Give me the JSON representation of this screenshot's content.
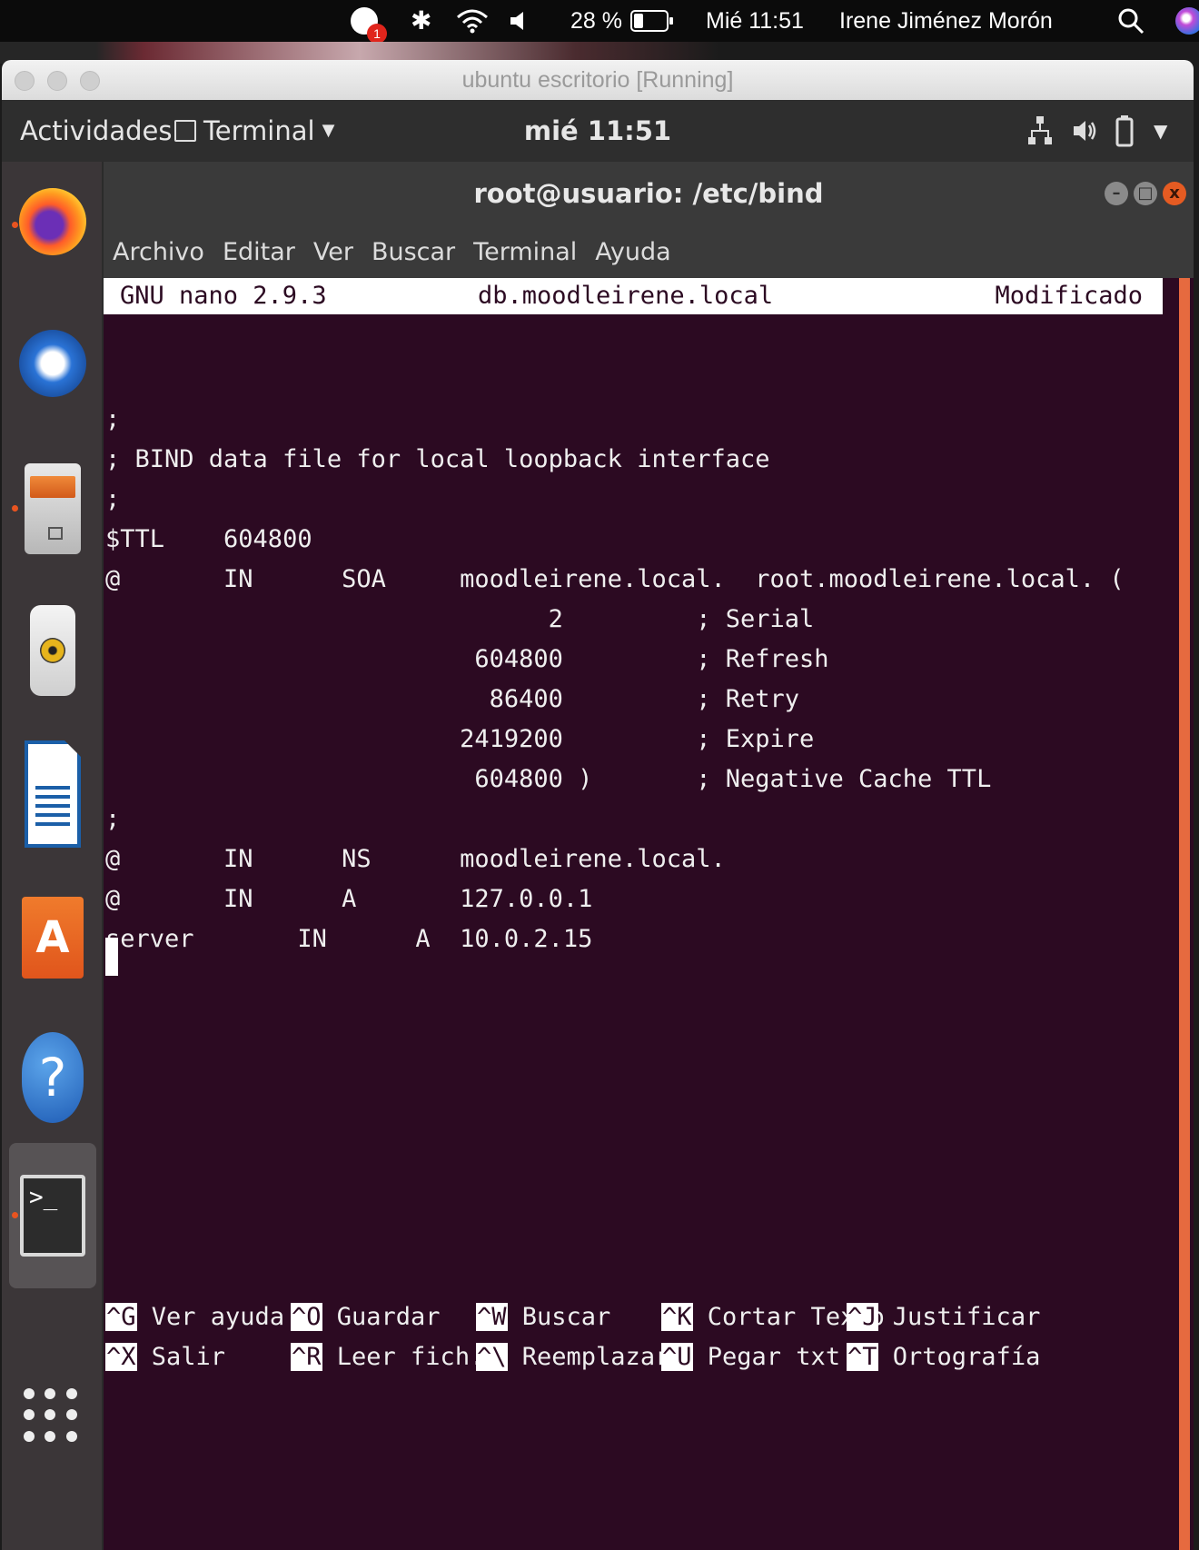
{
  "mac_menubar": {
    "chat_badge": "1",
    "battery_percent": "28 %",
    "battery_level": 0.28,
    "clock": "Mié 11:51",
    "user": "Irene Jiménez Morón"
  },
  "vbox": {
    "title": "ubuntu escritorio [Running]"
  },
  "gnome": {
    "activities": "Actividades",
    "app_name": "Terminal",
    "clock": "mié 11:51"
  },
  "dock": {
    "items": [
      "firefox-icon",
      "thunderbird-icon",
      "files-icon",
      "rhythmbox-icon",
      "libreoffice-writer-icon",
      "software-center-icon",
      "help-icon",
      "terminal-icon",
      "show-apps-icon"
    ]
  },
  "terminal": {
    "title": "root@usuario: /etc/bind",
    "menu": [
      "Archivo",
      "Editar",
      "Ver",
      "Buscar",
      "Terminal",
      "Ayuda"
    ]
  },
  "nano": {
    "version": "GNU nano 2.9.3",
    "filename": "db.moodleirene.local",
    "status": "Modificado",
    "lines": [
      ";",
      "; BIND data file for local loopback interface",
      ";",
      "$TTL    604800",
      "@       IN      SOA     moodleirene.local.  root.moodleirene.local. (",
      "                              2         ; Serial",
      "                         604800         ; Refresh",
      "                          86400         ; Retry",
      "                        2419200         ; Expire",
      "                         604800 )       ; Negative Cache TTL",
      ";",
      "@       IN      NS      moodleirene.local.",
      "@       IN      A       127.0.0.1",
      "server       IN      A  10.0.2.15"
    ],
    "shortcuts": [
      {
        "key": "^G",
        "label": " Ver ayuda"
      },
      {
        "key": "^O",
        "label": " Guardar"
      },
      {
        "key": "^W",
        "label": " Buscar"
      },
      {
        "key": "^K",
        "label": " Cortar Texto"
      },
      {
        "key": "^J",
        "label": " Justificar"
      },
      {
        "key": "^X",
        "label": " Salir"
      },
      {
        "key": "^R",
        "label": " Leer fich."
      },
      {
        "key": "^\\",
        "label": " Reemplazar"
      },
      {
        "key": "^U",
        "label": " Pegar txt"
      },
      {
        "key": "^T",
        "label": " Ortografía"
      }
    ]
  },
  "colors": {
    "terminal_bg": "#2c0a22",
    "ubuntu_orange": "#e95420"
  }
}
